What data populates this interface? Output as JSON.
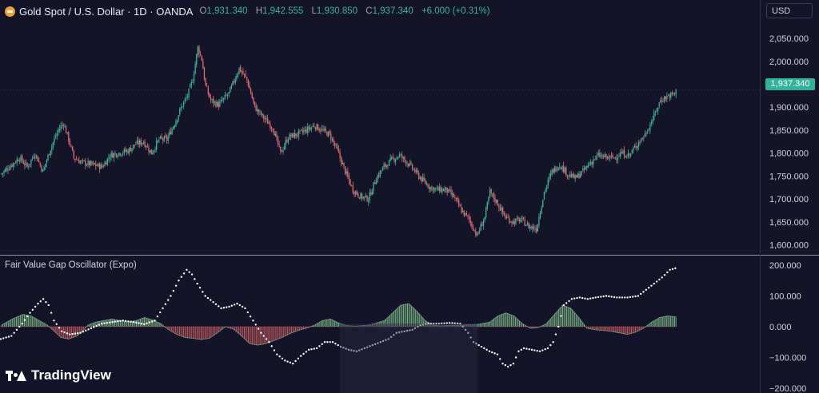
{
  "header": {
    "symbol": "Gold Spot / U.S. Dollar · 1D · OANDA",
    "o_label": "O",
    "o_value": "1,931.340",
    "h_label": "H",
    "h_value": "1,942.555",
    "l_label": "L",
    "l_value": "1,930.850",
    "c_label": "C",
    "c_value": "1,937.340",
    "change": "+6.000 (+0.31%)"
  },
  "currency_button": "USD",
  "last_price": "1,937.340",
  "oscillator_title": "Fair Value Gap Oscillator (Expo)",
  "brand": "TradingView",
  "icons": [
    "gold-coin-icon",
    "tradingview-logo-icon"
  ],
  "colors": {
    "background": "#131329",
    "up": "#3cb49a",
    "down": "#e46a6a",
    "osc_positive": "#8fd99a",
    "osc_negative": "#e66b6b",
    "dots": "#ffffff",
    "text": "#d1d4dc"
  },
  "chart_data": [
    {
      "type": "candlestick",
      "title": "Gold Spot / U.S. Dollar · 1D · OANDA",
      "ylim": [
        1580,
        2085
      ],
      "yticks": [
        "2,050.000",
        "2,000.000",
        "1,950.000",
        "1,900.000",
        "1,850.000",
        "1,800.000",
        "1,750.000",
        "1,700.000",
        "1,650.000",
        "1,600.000"
      ],
      "close_path": [
        [
          0,
          1755
        ],
        [
          8,
          1775
        ],
        [
          14,
          1790
        ],
        [
          20,
          1770
        ],
        [
          26,
          1800
        ],
        [
          32,
          1760
        ],
        [
          38,
          1810
        ],
        [
          44,
          1850
        ],
        [
          48,
          1865
        ],
        [
          52,
          1830
        ],
        [
          56,
          1790
        ],
        [
          62,
          1780
        ],
        [
          70,
          1775
        ],
        [
          78,
          1770
        ],
        [
          84,
          1795
        ],
        [
          90,
          1800
        ],
        [
          98,
          1805
        ],
        [
          104,
          1820
        ],
        [
          110,
          1825
        ],
        [
          116,
          1800
        ],
        [
          122,
          1830
        ],
        [
          128,
          1830
        ],
        [
          134,
          1865
        ],
        [
          140,
          1905
        ],
        [
          144,
          1925
        ],
        [
          148,
          1960
        ],
        [
          152,
          2030
        ],
        [
          155,
          2005
        ],
        [
          158,
          1945
        ],
        [
          162,
          1915
        ],
        [
          168,
          1905
        ],
        [
          176,
          1930
        ],
        [
          184,
          1985
        ],
        [
          190,
          1960
        ],
        [
          196,
          1900
        ],
        [
          202,
          1880
        ],
        [
          210,
          1855
        ],
        [
          216,
          1800
        ],
        [
          222,
          1835
        ],
        [
          228,
          1840
        ],
        [
          236,
          1850
        ],
        [
          242,
          1860
        ],
        [
          248,
          1850
        ],
        [
          254,
          1840
        ],
        [
          260,
          1805
        ],
        [
          266,
          1760
        ],
        [
          272,
          1720
        ],
        [
          278,
          1705
        ],
        [
          284,
          1700
        ],
        [
          290,
          1745
        ],
        [
          296,
          1770
        ],
        [
          302,
          1785
        ],
        [
          308,
          1795
        ],
        [
          314,
          1780
        ],
        [
          320,
          1760
        ],
        [
          326,
          1740
        ],
        [
          332,
          1725
        ],
        [
          338,
          1720
        ],
        [
          344,
          1720
        ],
        [
          350,
          1705
        ],
        [
          356,
          1675
        ],
        [
          362,
          1655
        ],
        [
          368,
          1620
        ],
        [
          374,
          1660
        ],
        [
          378,
          1715
        ],
        [
          384,
          1690
        ],
        [
          390,
          1660
        ],
        [
          396,
          1650
        ],
        [
          402,
          1655
        ],
        [
          408,
          1640
        ],
        [
          414,
          1635
        ],
        [
          420,
          1715
        ],
        [
          426,
          1760
        ],
        [
          432,
          1775
        ],
        [
          438,
          1755
        ],
        [
          444,
          1745
        ],
        [
          450,
          1760
        ],
        [
          456,
          1780
        ],
        [
          462,
          1795
        ],
        [
          468,
          1790
        ],
        [
          474,
          1790
        ],
        [
          480,
          1800
        ],
        [
          486,
          1795
        ],
        [
          492,
          1820
        ],
        [
          498,
          1840
        ],
        [
          504,
          1875
        ],
        [
          510,
          1915
        ],
        [
          516,
          1925
        ],
        [
          522,
          1930
        ]
      ]
    },
    {
      "type": "area+scatter",
      "title": "Fair Value Gap Oscillator (Expo)",
      "ylim": [
        -200,
        200
      ],
      "yticks": [
        "200.000",
        "100.000",
        "0.000",
        "−100.000",
        "−200.000"
      ],
      "histogram_path": [
        [
          0,
          5
        ],
        [
          8,
          25
        ],
        [
          16,
          40
        ],
        [
          22,
          35
        ],
        [
          28,
          20
        ],
        [
          34,
          5
        ],
        [
          38,
          -10
        ],
        [
          44,
          -35
        ],
        [
          50,
          -40
        ],
        [
          56,
          -30
        ],
        [
          60,
          -15
        ],
        [
          64,
          5
        ],
        [
          70,
          15
        ],
        [
          76,
          20
        ],
        [
          82,
          25
        ],
        [
          88,
          20
        ],
        [
          94,
          15
        ],
        [
          100,
          20
        ],
        [
          106,
          30
        ],
        [
          112,
          22
        ],
        [
          118,
          10
        ],
        [
          124,
          -10
        ],
        [
          130,
          -25
        ],
        [
          136,
          -35
        ],
        [
          142,
          -38
        ],
        [
          148,
          -42
        ],
        [
          154,
          -38
        ],
        [
          160,
          -20
        ],
        [
          166,
          0
        ],
        [
          172,
          -8
        ],
        [
          178,
          -30
        ],
        [
          184,
          -55
        ],
        [
          190,
          -60
        ],
        [
          196,
          -55
        ],
        [
          202,
          -45
        ],
        [
          208,
          -35
        ],
        [
          214,
          -22
        ],
        [
          220,
          -12
        ],
        [
          226,
          -5
        ],
        [
          232,
          5
        ],
        [
          238,
          20
        ],
        [
          244,
          25
        ],
        [
          250,
          12
        ],
        [
          256,
          4
        ],
        [
          262,
          2
        ],
        [
          268,
          4
        ],
        [
          272,
          5
        ],
        [
          278,
          12
        ],
        [
          284,
          20
        ],
        [
          290,
          45
        ],
        [
          296,
          70
        ],
        [
          302,
          75
        ],
        [
          308,
          50
        ],
        [
          314,
          20
        ],
        [
          320,
          5
        ],
        [
          326,
          3
        ],
        [
          334,
          4
        ],
        [
          344,
          6
        ],
        [
          354,
          8
        ],
        [
          362,
          15
        ],
        [
          368,
          35
        ],
        [
          374,
          45
        ],
        [
          380,
          35
        ],
        [
          386,
          10
        ],
        [
          392,
          -5
        ],
        [
          398,
          -3
        ],
        [
          404,
          10
        ],
        [
          410,
          40
        ],
        [
          416,
          70
        ],
        [
          422,
          60
        ],
        [
          428,
          30
        ],
        [
          434,
          -5
        ],
        [
          440,
          -10
        ],
        [
          446,
          -12
        ],
        [
          452,
          -15
        ],
        [
          458,
          -20
        ],
        [
          464,
          -25
        ],
        [
          470,
          -18
        ],
        [
          476,
          -5
        ],
        [
          482,
          15
        ],
        [
          488,
          30
        ],
        [
          494,
          35
        ],
        [
          500,
          32
        ]
      ],
      "dots_path": [
        [
          0,
          -40
        ],
        [
          8,
          -30
        ],
        [
          16,
          10
        ],
        [
          22,
          45
        ],
        [
          28,
          75
        ],
        [
          32,
          90
        ],
        [
          36,
          70
        ],
        [
          40,
          20
        ],
        [
          46,
          -15
        ],
        [
          52,
          -25
        ],
        [
          60,
          -20
        ],
        [
          68,
          -5
        ],
        [
          76,
          10
        ],
        [
          84,
          15
        ],
        [
          92,
          20
        ],
        [
          100,
          15
        ],
        [
          108,
          8
        ],
        [
          116,
          20
        ],
        [
          122,
          60
        ],
        [
          128,
          100
        ],
        [
          134,
          150
        ],
        [
          140,
          185
        ],
        [
          144,
          170
        ],
        [
          148,
          140
        ],
        [
          154,
          100
        ],
        [
          160,
          80
        ],
        [
          166,
          60
        ],
        [
          172,
          65
        ],
        [
          178,
          75
        ],
        [
          184,
          60
        ],
        [
          190,
          20
        ],
        [
          196,
          -20
        ],
        [
          202,
          -50
        ],
        [
          208,
          -90
        ],
        [
          214,
          -110
        ],
        [
          220,
          -120
        ],
        [
          226,
          -95
        ],
        [
          232,
          -75
        ],
        [
          238,
          -70
        ],
        [
          244,
          -50
        ],
        [
          250,
          -50
        ],
        [
          256,
          -65
        ],
        [
          262,
          -75
        ],
        [
          268,
          -80
        ],
        [
          274,
          -70
        ],
        [
          280,
          -60
        ],
        [
          286,
          -50
        ],
        [
          292,
          -40
        ],
        [
          298,
          -20
        ],
        [
          304,
          -15
        ],
        [
          310,
          -10
        ],
        [
          316,
          5
        ],
        [
          322,
          10
        ],
        [
          330,
          10
        ],
        [
          338,
          12
        ],
        [
          346,
          10
        ],
        [
          352,
          -20
        ],
        [
          356,
          -50
        ],
        [
          362,
          -65
        ],
        [
          368,
          -80
        ],
        [
          374,
          -90
        ],
        [
          378,
          -120
        ],
        [
          382,
          -130
        ],
        [
          386,
          -120
        ],
        [
          390,
          -80
        ],
        [
          394,
          -70
        ],
        [
          400,
          -75
        ],
        [
          406,
          -80
        ],
        [
          412,
          -70
        ],
        [
          416,
          -50
        ],
        [
          420,
          0
        ],
        [
          424,
          70
        ],
        [
          430,
          90
        ],
        [
          436,
          95
        ],
        [
          442,
          90
        ],
        [
          448,
          95
        ],
        [
          456,
          100
        ],
        [
          464,
          95
        ],
        [
          472,
          95
        ],
        [
          480,
          100
        ],
        [
          486,
          120
        ],
        [
          492,
          140
        ],
        [
          498,
          160
        ],
        [
          504,
          185
        ],
        [
          508,
          190
        ]
      ]
    }
  ]
}
